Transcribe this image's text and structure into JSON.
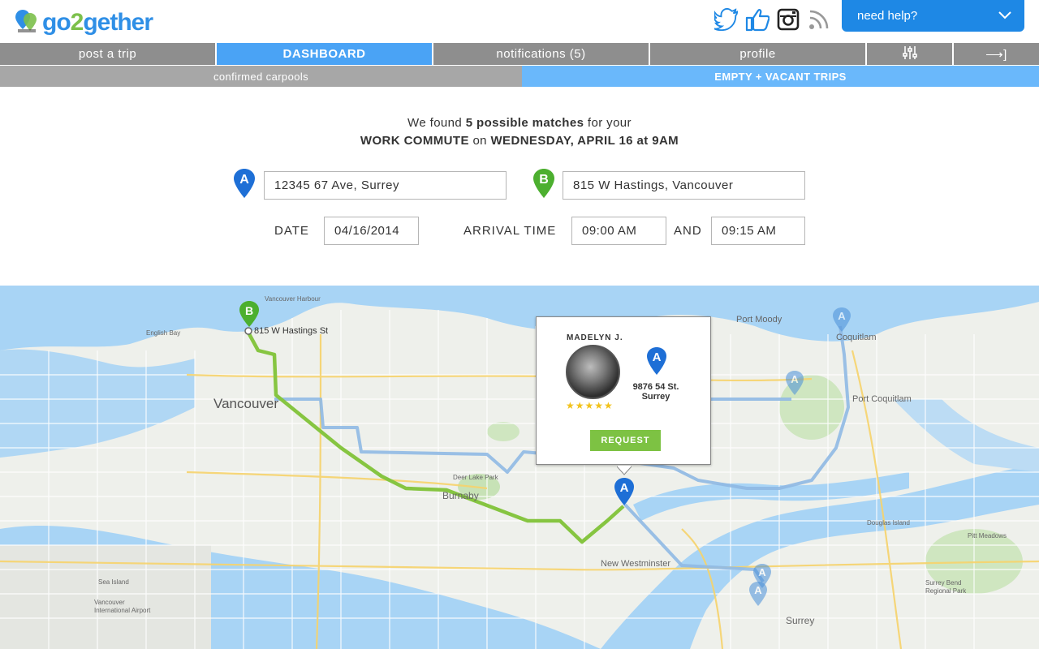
{
  "brand": {
    "name_start": "go",
    "name_digit": "2",
    "name_end": "gether"
  },
  "social": {
    "icons": [
      "twitter-icon",
      "thumbs-up-icon",
      "instagram-icon",
      "rss-icon"
    ]
  },
  "help": {
    "label": "need help?"
  },
  "nav": {
    "post_trip": "post a trip",
    "dashboard": "DASHBOARD",
    "notifications": "notifications (5)",
    "profile": "profile",
    "filters_icon": "sliders-icon",
    "logout_glyph": "⟶]"
  },
  "subnav": {
    "confirmed": "confirmed carpools",
    "empty": "EMPTY + VACANT TRIPS"
  },
  "search": {
    "heading_pre": "We found ",
    "heading_count": "5 possible matches",
    "heading_post": " for your",
    "heading_trip": "WORK COMMUTE",
    "heading_on": " on ",
    "heading_when": "WEDNESDAY, APRIL 16 at 9AM",
    "origin_marker": "A",
    "origin": "12345 67 Ave, Surrey",
    "destination_marker": "B",
    "destination": "815 W Hastings, Vancouver",
    "date_label": "DATE",
    "date": "04/16/2014",
    "arrival_label": "ARRIVAL TIME",
    "arrival_from": "09:00 AM",
    "and_label": "AND",
    "arrival_to": "09:15 AM"
  },
  "map": {
    "labels": {
      "vancouver": "Vancouver",
      "burnaby": "Burnaby",
      "new_westminster": "New Westminster",
      "coquitlam": "Coquitlam",
      "port_moody": "Port Moody",
      "port_coquitlam": "Port Coquitlam",
      "surrey": "Surrey",
      "english_bay": "English Bay",
      "sea_island": "Sea Island",
      "vancouver_airport": "Vancouver International Airport",
      "deer_lake_park": "Deer Lake Park",
      "pitt_meadows": "Pitt Meadows",
      "douglas_island": "Douglas Island",
      "surrey_bend": "Surrey Bend Regional Park",
      "dest_pin_label": "815 W Hastings St",
      "carpool_harbour": "Vancouver Harbour"
    },
    "dest_marker": "B",
    "origin_marker": "A"
  },
  "match": {
    "name": "MADELYN J.",
    "rating": "★★★★★",
    "pin_marker": "A",
    "address_line1": "9876 54 St.",
    "address_line2": "Surrey",
    "request_label": "REQUEST"
  },
  "colors": {
    "primary": "#1e88e5",
    "green": "#7dc243",
    "nav_gray": "#8e8e8e"
  }
}
